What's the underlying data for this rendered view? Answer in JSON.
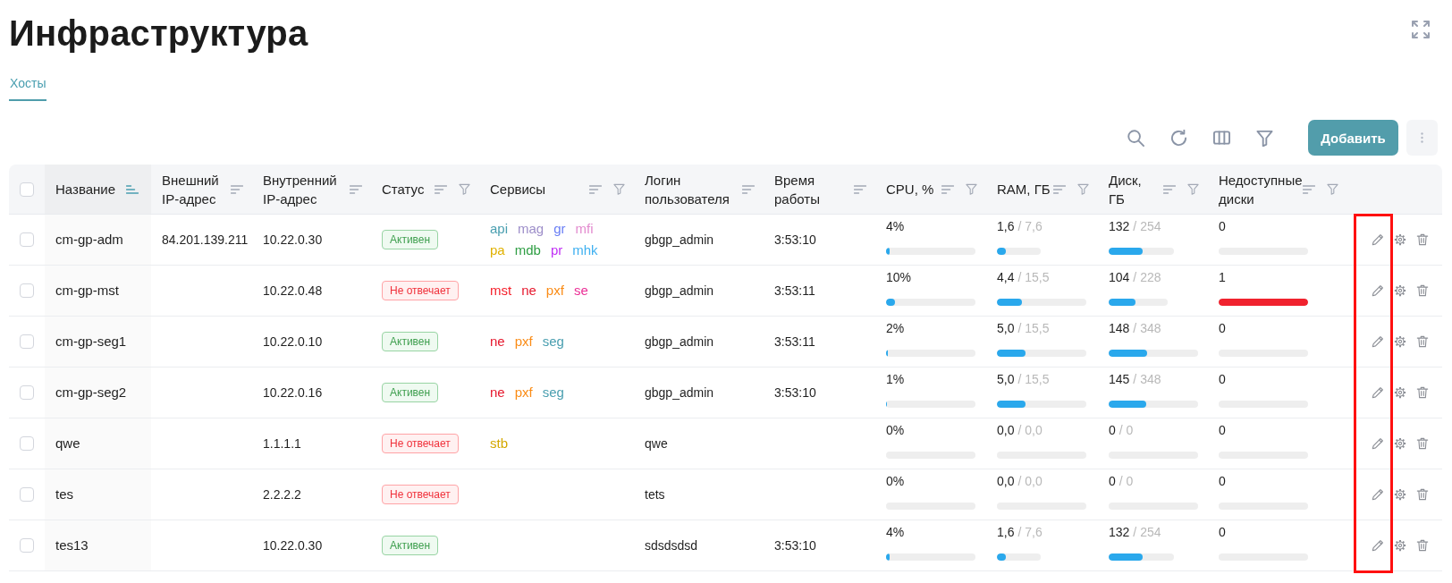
{
  "page": {
    "title": "Инфраструктура"
  },
  "tabs": [
    {
      "label": "Хосты",
      "selected": true
    }
  ],
  "toolbar": {
    "add_button": "Добавить"
  },
  "table": {
    "select_all": {
      "checked": false
    },
    "actions_highlighted": true,
    "columns": [
      {
        "label": "Название",
        "sorted": true,
        "filterable": false
      },
      {
        "label": "Внешний\nIP-адрес",
        "sorted": false,
        "filterable": false
      },
      {
        "label": "Внутренний\nIP-адрес",
        "sorted": false,
        "filterable": false
      },
      {
        "label": "Статус",
        "sorted": false,
        "filterable": true
      },
      {
        "label": "Сервисы",
        "sorted": false,
        "filterable": true
      },
      {
        "label": "Логин\nпользователя",
        "sorted": false,
        "filterable": false
      },
      {
        "label": "Время\nработы",
        "sorted": false,
        "filterable": false
      },
      {
        "label": "CPU, %",
        "sorted": false,
        "filterable": true
      },
      {
        "label": "RAM, ГБ",
        "sorted": false,
        "filterable": true
      },
      {
        "label": "Диск,\nГБ",
        "sorted": false,
        "filterable": true
      },
      {
        "label": "Недоступные\nдиски",
        "sorted": false,
        "filterable": true
      }
    ],
    "rows": [
      {
        "checked": false,
        "name": "cm-gp-adm",
        "external_ip": "84.201.139.211",
        "internal_ip": "10.22.0.30",
        "status": {
          "label": "Активен",
          "kind": "active"
        },
        "services": [
          {
            "label": "api",
            "color": "#4a9fb0"
          },
          {
            "label": "mag",
            "color": "#9d8ec9"
          },
          {
            "label": "gr",
            "color": "#6a7ff5"
          },
          {
            "label": "mfi",
            "color": "#e38ccf"
          },
          {
            "label": "pa",
            "color": "#e0b100"
          },
          {
            "label": "mdb",
            "color": "#2f9e44"
          },
          {
            "label": "pr",
            "color": "#c02ff5"
          },
          {
            "label": "mhk",
            "color": "#3fb0f0"
          }
        ],
        "login": "gbgp_admin",
        "uptime": "3:53:10",
        "cpu": {
          "value": "4%",
          "level": 0.04
        },
        "ram": {
          "value": "1,6",
          "total": "/ 7,6",
          "level": 0.21
        },
        "disk": {
          "value": "132",
          "total": "/ 254",
          "level": 0.52
        },
        "unavailable_disks": {
          "value": "0",
          "level": 0
        }
      },
      {
        "checked": false,
        "name": "cm-gp-mst",
        "internal_ip": "10.22.0.48",
        "status": {
          "label": "Не отвечает",
          "kind": "not_responding"
        },
        "services": [
          {
            "label": "mst",
            "color": "#f5222d"
          },
          {
            "label": "ne",
            "color": "#e6192e"
          },
          {
            "label": "pxf",
            "color": "#fa8c16"
          },
          {
            "label": "se",
            "color": "#eb2f96"
          }
        ],
        "login": "gbgp_admin",
        "uptime": "3:53:11",
        "cpu": {
          "value": "10%",
          "level": 0.1
        },
        "ram": {
          "value": "4,4",
          "total": "/ 15,5",
          "level": 0.28
        },
        "disk": {
          "value": "104",
          "total": "/ 228",
          "level": 0.46
        },
        "unavailable_disks": {
          "value": "1",
          "level": 1
        }
      },
      {
        "checked": false,
        "name": "cm-gp-seg1",
        "internal_ip": "10.22.0.10",
        "status": {
          "label": "Активен",
          "kind": "active"
        },
        "services": [
          {
            "label": "ne",
            "color": "#e6192e"
          },
          {
            "label": "pxf",
            "color": "#fa8c16"
          },
          {
            "label": "seg",
            "color": "#4a9fb0"
          }
        ],
        "login": "gbgp_admin",
        "uptime": "3:53:11",
        "cpu": {
          "value": "2%",
          "level": 0.02
        },
        "ram": {
          "value": "5,0",
          "total": "/ 15,5",
          "level": 0.32
        },
        "disk": {
          "value": "148",
          "total": "/ 348",
          "level": 0.43
        },
        "unavailable_disks": {
          "value": "0",
          "level": 0
        }
      },
      {
        "checked": false,
        "name": "cm-gp-seg2",
        "internal_ip": "10.22.0.16",
        "status": {
          "label": "Активен",
          "kind": "active"
        },
        "services": [
          {
            "label": "ne",
            "color": "#e6192e"
          },
          {
            "label": "pxf",
            "color": "#fa8c16"
          },
          {
            "label": "seg",
            "color": "#4a9fb0"
          }
        ],
        "login": "gbgp_admin",
        "uptime": "3:53:10",
        "cpu": {
          "value": "1%",
          "level": 0.01
        },
        "ram": {
          "value": "5,0",
          "total": "/ 15,5",
          "level": 0.32
        },
        "disk": {
          "value": "145",
          "total": "/ 348",
          "level": 0.42
        },
        "unavailable_disks": {
          "value": "0",
          "level": 0
        }
      },
      {
        "checked": false,
        "name": "qwe",
        "internal_ip": "1.1.1.1",
        "status": {
          "label": "Не отвечает",
          "kind": "not_responding"
        },
        "services": [
          {
            "label": "stb",
            "color": "#d4a800"
          }
        ],
        "login": "qwe",
        "cpu": {
          "value": "0%",
          "level": 0
        },
        "ram": {
          "value": "0,0",
          "total": "/ 0,0",
          "level": 0
        },
        "disk": {
          "value": "0",
          "total": "/ 0",
          "level": 0
        },
        "unavailable_disks": {
          "value": "0",
          "level": 0
        }
      },
      {
        "checked": false,
        "name": "tes",
        "internal_ip": "2.2.2.2",
        "status": {
          "label": "Не отвечает",
          "kind": "not_responding"
        },
        "login": "tets",
        "cpu": {
          "value": "0%",
          "level": 0
        },
        "ram": {
          "value": "0,0",
          "total": "/ 0,0",
          "level": 0
        },
        "disk": {
          "value": "0",
          "total": "/ 0",
          "level": 0
        },
        "unavailable_disks": {
          "value": "0",
          "level": 0
        }
      },
      {
        "checked": false,
        "name": "tes13",
        "internal_ip": "10.22.0.30",
        "status": {
          "label": "Активен",
          "kind": "active"
        },
        "login": "sdsdsdsd",
        "uptime": "3:53:10",
        "cpu": {
          "value": "4%",
          "level": 0.04
        },
        "ram": {
          "value": "1,6",
          "total": "/ 7,6",
          "level": 0.21
        },
        "disk": {
          "value": "132",
          "total": "/ 254",
          "level": 0.52
        },
        "unavailable_disks": {
          "value": "0",
          "level": 0
        }
      }
    ]
  }
}
